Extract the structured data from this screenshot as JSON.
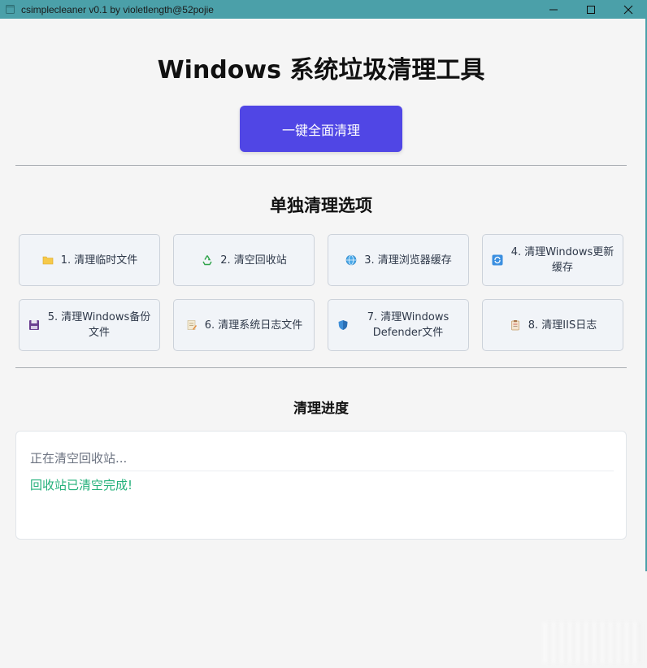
{
  "window": {
    "title": "csimplecleaner v0.1 by violetlength@52pojie",
    "accent": "#4ba0a9"
  },
  "header": {
    "title": "Windows 系统垃圾清理工具",
    "clean_all_label": "一键全面清理",
    "clean_all_color": "#5046e5"
  },
  "options": {
    "title": "单独清理选项",
    "items": [
      {
        "label": "1. 清理临时文件",
        "icon": "folder-icon"
      },
      {
        "label": "2. 清空回收站",
        "icon": "recycle-icon"
      },
      {
        "label": "3. 清理浏览器缓存",
        "icon": "globe-icon"
      },
      {
        "label": "4. 清理Windows更新缓存",
        "icon": "refresh-icon"
      },
      {
        "label": "5. 清理Windows备份文件",
        "icon": "floppy-icon"
      },
      {
        "label": "6. 清理系统日志文件",
        "icon": "memo-icon"
      },
      {
        "label": "7. 清理Windows Defender文件",
        "icon": "shield-icon"
      },
      {
        "label": "8. 清理IIS日志",
        "icon": "clipboard-icon"
      }
    ]
  },
  "progress": {
    "title": "清理进度",
    "lines": [
      {
        "text": "正在清空回收站...",
        "status": "info"
      },
      {
        "text": "回收站已清空完成!",
        "status": "success",
        "color": "#23b07a"
      }
    ]
  }
}
